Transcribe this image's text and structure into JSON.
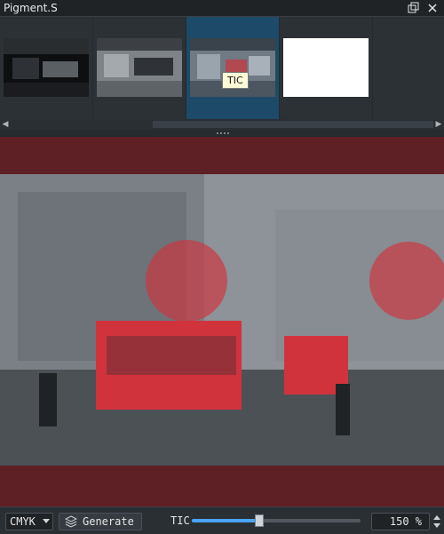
{
  "window": {
    "title": "Pigment.S"
  },
  "icons": {
    "restore": "restore-icon",
    "close": "close-icon"
  },
  "thumbnails": {
    "tooltip": "TIC",
    "items": [
      {
        "name": "thumbnail-1",
        "variant": "black-and-white"
      },
      {
        "name": "thumbnail-2",
        "variant": "grayscale"
      },
      {
        "name": "thumbnail-3",
        "variant": "selected"
      },
      {
        "name": "thumbnail-4",
        "variant": "empty-white"
      }
    ]
  },
  "toolbar": {
    "mode_value": "CMYK",
    "generate_label": "Generate",
    "tic_label": "TIC",
    "tic_level": 0.4,
    "zoom_value": "150 %"
  },
  "colors": {
    "background": "#2b2f33",
    "preview_bg": "#5e1f25",
    "selected": "#1d4a69",
    "accent": "#4aa3ff",
    "highlight_red": "#d1333d"
  }
}
